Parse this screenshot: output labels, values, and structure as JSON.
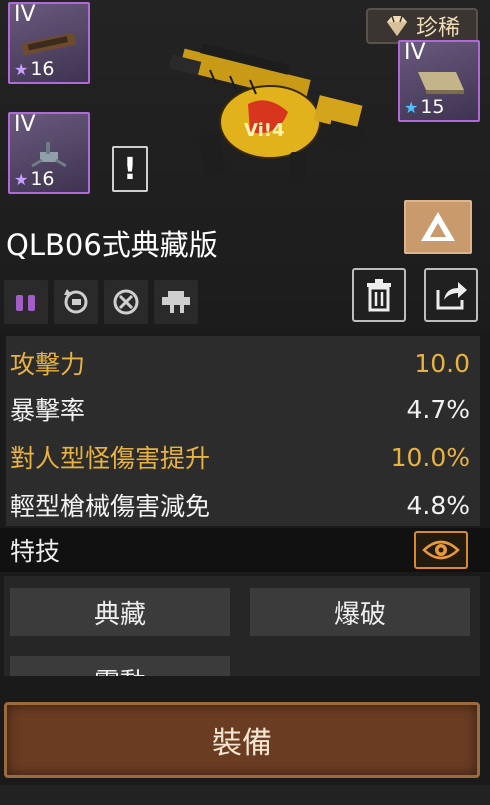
{
  "rarity": {
    "label": "珍稀",
    "icon": "diamond-icon",
    "color": "#f0dcb8"
  },
  "slots": [
    {
      "tier": "IV",
      "level": "16",
      "star_color": "#c9a0ff",
      "item": "ammo-magazine-icon"
    },
    {
      "tier": "IV",
      "level": "16",
      "star_color": "#c9a0ff",
      "item": "turret-icon"
    },
    {
      "tier": "IV",
      "level": "15",
      "star_color": "#4ec0ff",
      "item": "armor-plate-icon"
    }
  ],
  "warning": {
    "label": "!"
  },
  "weapon": {
    "name": "QLB06式典藏版",
    "icon": "grenade-launcher-icon"
  },
  "mod_icons": [
    "ammo-icon",
    "reload-icon",
    "accuracy-icon",
    "scope-icon"
  ],
  "stats": [
    {
      "label": "攻擊力",
      "value": "10.0",
      "color": "#e8b23e"
    },
    {
      "label": "暴擊率",
      "value": "4.7%",
      "color": "#f2f2f2"
    },
    {
      "label": "對人型怪傷害提升",
      "value": "10.0%",
      "color": "#e8b23e"
    },
    {
      "label": "輕型槍械傷害減免",
      "value": "4.8%",
      "color": "#f2f2f2"
    }
  ],
  "skills_section": {
    "label": "特技"
  },
  "skills": [
    {
      "label": "典藏"
    },
    {
      "label": "爆破"
    },
    {
      "label": "震動"
    }
  ],
  "equip": {
    "label": "裝備"
  }
}
